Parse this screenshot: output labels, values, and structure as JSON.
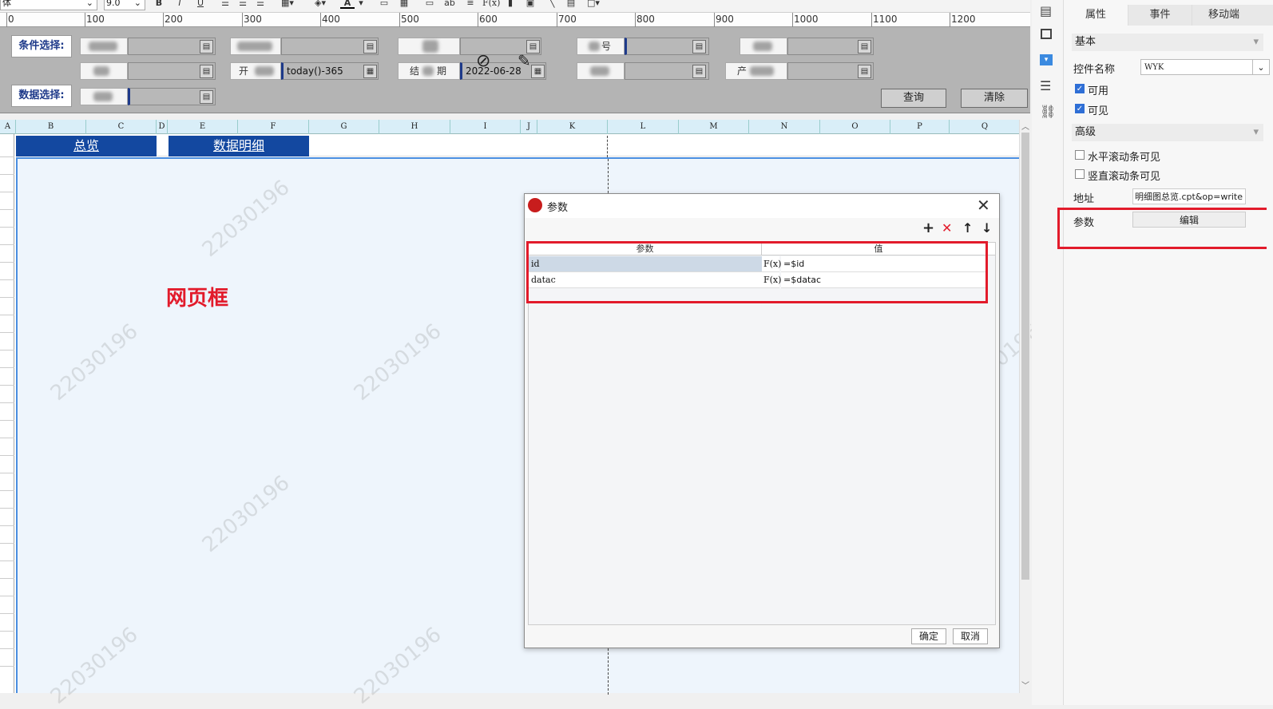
{
  "toolbar": {
    "font_name": "体",
    "font_size": "9.0",
    "bold": "B",
    "italic": "I",
    "underline": "U",
    "text_color_glyph": "A",
    "ab_label": "ab",
    "formula_label": "F(x)"
  },
  "ruler": {
    "labels": [
      "0",
      "100",
      "200",
      "300",
      "400",
      "500",
      "600",
      "700",
      "800",
      "900",
      "1000",
      "1100",
      "1200"
    ]
  },
  "params": {
    "condition_label": "条件选择:",
    "data_label": "数据选择:",
    "start_label": "开",
    "start_value": "today()-365",
    "end_label": "结",
    "end_label_tail": "期",
    "end_value": "2022-06-28",
    "label_x": "号",
    "label_y": "",
    "label_z": "产",
    "query_button": "查询",
    "clear_button": "清除"
  },
  "sheet": {
    "columns": [
      "A",
      "B",
      "C",
      "D",
      "E",
      "F",
      "G",
      "H",
      "I",
      "J",
      "K",
      "L",
      "M",
      "N",
      "O",
      "P",
      "Q"
    ],
    "tab_overview": "总览",
    "tab_details": "数据明细",
    "web_frame_label": "网页框",
    "watermark": "22030196"
  },
  "right_panel": {
    "tabs": [
      "属性",
      "事件",
      "移动端"
    ],
    "section_basic": "基本",
    "control_name_label": "控件名称",
    "control_name_value": "WYK",
    "enabled_label": "可用",
    "visible_label": "可见",
    "section_advanced": "高级",
    "hscroll_label": "水平滚动条可见",
    "vscroll_label": "竖直滚动条可见",
    "address_label": "地址",
    "address_value": "明细图总览.cpt&op=write",
    "param_label": "参数",
    "edit_button": "编辑",
    "enabled_checked": true,
    "visible_checked": true,
    "hscroll_checked": false,
    "vscroll_checked": false
  },
  "dialog": {
    "title": "参数",
    "col_param": "参数",
    "col_value": "值",
    "rows": [
      {
        "name": "id",
        "fx": "F(x)",
        "value": "=$id"
      },
      {
        "name": "datac",
        "fx": "F(x)",
        "value": "=$datac"
      }
    ],
    "ok_button": "确定",
    "cancel_button": "取消"
  },
  "colors": {
    "accent_blue": "#1348a0",
    "highlight_red": "#e21b2b",
    "frame_bg": "#eef5fc"
  }
}
